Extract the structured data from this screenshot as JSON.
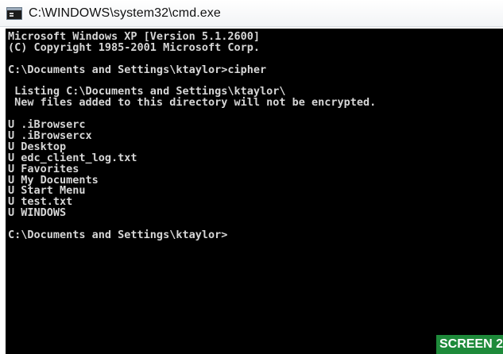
{
  "window": {
    "title": "C:\\WINDOWS\\system32\\cmd.exe",
    "icon": "console-icon"
  },
  "console": {
    "lines": [
      "Microsoft Windows XP [Version 5.1.2600]",
      "(C) Copyright 1985-2001 Microsoft Corp.",
      "",
      "C:\\Documents and Settings\\ktaylor>cipher",
      "",
      " Listing C:\\Documents and Settings\\ktaylor\\",
      " New files added to this directory will not be encrypted.",
      "",
      "U .iBrowserc",
      "U .iBrowsercx",
      "U Desktop",
      "U edc_client_log.txt",
      "U Favorites",
      "U My Documents",
      "U Start Menu",
      "U test.txt",
      "U WINDOWS",
      "",
      "C:\\Documents and Settings\\ktaylor>"
    ]
  },
  "badge": {
    "label": "SCREEN 2"
  },
  "colors": {
    "console_bg": "#000000",
    "console_text": "#d6d6d6",
    "badge_bg": "#1e8a3a"
  }
}
